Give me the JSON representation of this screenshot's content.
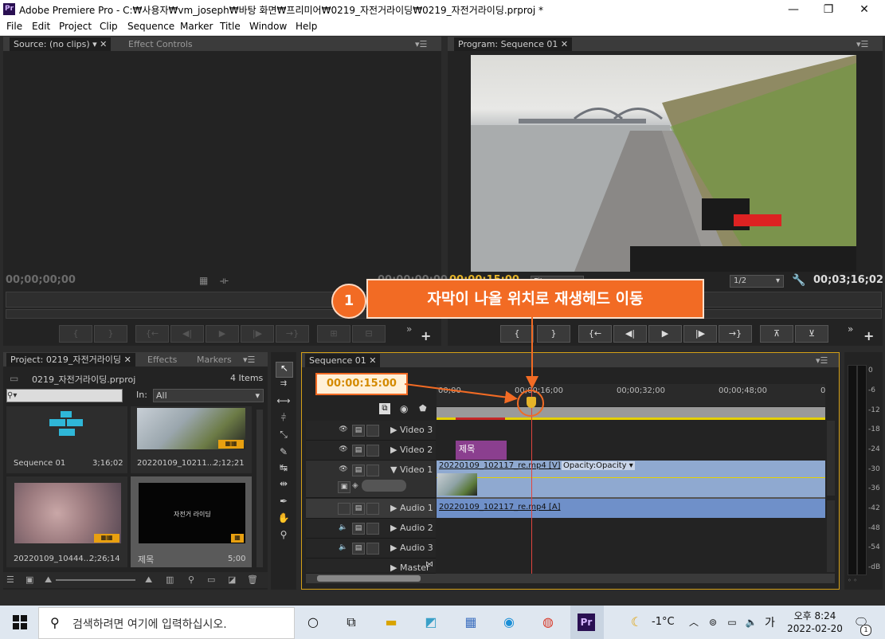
{
  "window": {
    "app_badge": "Pr",
    "title": "Adobe Premiere Pro - C:₩사용자₩vm_joseph₩바탕 화면₩프리미어₩0219_자전거라이딩₩0219_자전거라이딩.prproj *",
    "minimize": "—",
    "maximize": "❐",
    "close": "✕"
  },
  "menu": [
    "File",
    "Edit",
    "Project",
    "Clip",
    "Sequence",
    "Marker",
    "Title",
    "Window",
    "Help"
  ],
  "source_panel": {
    "tab_source": "Source: (no clips)",
    "tab_effect_controls": "Effect Controls",
    "timecode": "00;00;00;00",
    "timecode_right": "00;00;00;00"
  },
  "program_panel": {
    "tab": "Program: Sequence 01",
    "timecode": "00;00;15;00",
    "fit": "Fit",
    "zoom": "1/2",
    "duration": "00;03;16;02"
  },
  "callout": {
    "number": "1",
    "text": "자막이 나올 위치로 재생헤드 이동",
    "timecode_box": "00:00:15:00"
  },
  "project_panel": {
    "tab": "Project: 0219_자전거라이딩",
    "tab_effects": "Effects",
    "tab_markers": "Markers",
    "file": "0219_자전거라이딩.prproj",
    "count": "4 Items",
    "in_label": "In:",
    "in_value": "All",
    "items": [
      {
        "name": "Sequence 01",
        "duration": "3;16;02"
      },
      {
        "name": "20220109_10211...",
        "duration": "2;12;21"
      },
      {
        "name": "20220109_10444...",
        "duration": "2;26;14"
      },
      {
        "name": "제목",
        "duration": "5;00"
      }
    ],
    "title_thumb_text": "자전거 라이딩"
  },
  "timeline": {
    "tab": "Sequence 01",
    "ruler": [
      "00;00",
      "00;00;16;00",
      "00;00;32;00",
      "00;00;48;00",
      "0"
    ],
    "tracks": [
      {
        "name": "Video 3"
      },
      {
        "name": "Video 2"
      },
      {
        "name": "Video 1"
      },
      {
        "name": "Audio 1"
      },
      {
        "name": "Audio 2"
      },
      {
        "name": "Audio 3"
      },
      {
        "name": "Master"
      }
    ],
    "title_clip": "제목",
    "video_clip": "20220109_102117_re.mp4 [V]",
    "video_clip_fx": "Opacity:Opacity ▾",
    "audio_clip": "20220109_102117_re.mp4 [A]"
  },
  "meter": {
    "labels": [
      "0",
      "-6",
      "-12",
      "-18",
      "-24",
      "-30",
      "-36",
      "-42",
      "-48",
      "-54",
      "-dB"
    ],
    "footer": "◦ ◦"
  },
  "taskbar": {
    "search_placeholder": "검색하려면 여기에 입력하십시오.",
    "temperature": "-1°C",
    "ime": "가",
    "time": "오후 8:24",
    "date": "2022-02-20",
    "notif_count": "1"
  }
}
